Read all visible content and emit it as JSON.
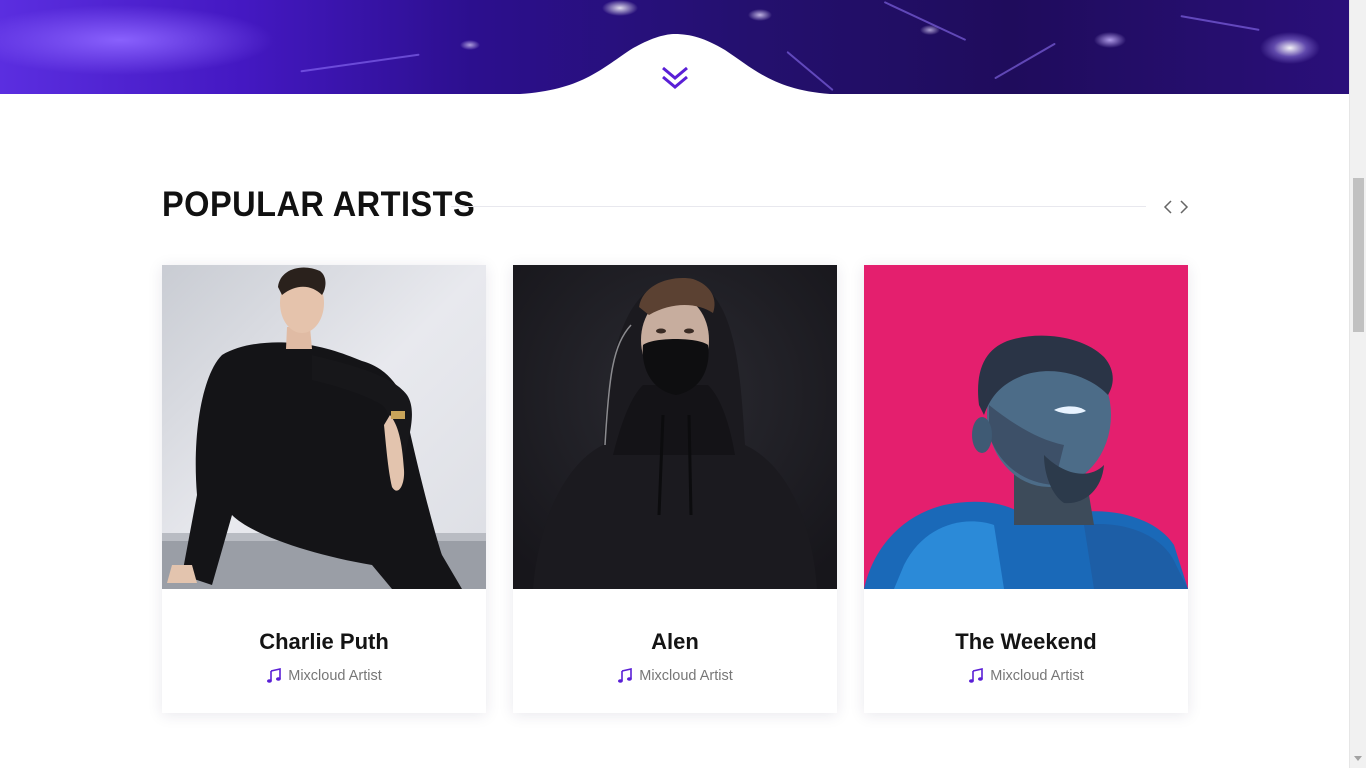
{
  "section": {
    "title": "POPULAR ARTISTS",
    "prev_icon": "chevron-left-icon",
    "next_icon": "chevron-right-icon"
  },
  "hero": {
    "scroll_icon": "double-chevron-down-icon"
  },
  "artists": [
    {
      "name": "Charlie Puth",
      "role": "Mixcloud Artist",
      "icon": "music-note-icon"
    },
    {
      "name": "Alen",
      "role": "Mixcloud Artist",
      "icon": "music-note-icon"
    },
    {
      "name": "The Weekend",
      "role": "Mixcloud Artist",
      "icon": "music-note-icon"
    }
  ],
  "colors": {
    "accent": "#5a1fd6",
    "hero_dark": "#1f0c5c",
    "hero_light": "#5b2ee0",
    "weekend_bg": "#e41f6e",
    "alen_bg": "#1c1b22",
    "charlie_bg": "#e7e8ec"
  },
  "scrollbar": {
    "position": 0.3
  }
}
